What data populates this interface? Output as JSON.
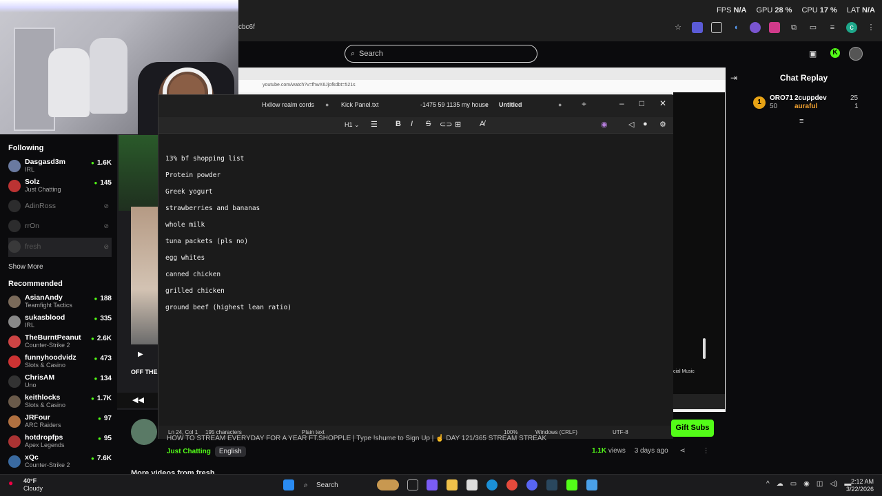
{
  "perf": {
    "fps_label": "FPS",
    "fps": "N/A",
    "gpu_label": "GPU",
    "gpu": "28 %",
    "cpu_label": "CPU",
    "cpu": "17 %",
    "lat_label": "LAT",
    "lat": "N/A"
  },
  "browser": {
    "url_fragment": "cbc6f"
  },
  "kick": {
    "search_placeholder": "Search"
  },
  "sidebar": {
    "following_title": "Following",
    "following": [
      {
        "name": "Dasgasd3m",
        "category": "IRL",
        "viewers": "1.6K"
      },
      {
        "name": "Solz",
        "category": "Just Chatting",
        "viewers": "145"
      }
    ],
    "offline": [
      {
        "name": "AdinRoss"
      },
      {
        "name": "rrOn"
      },
      {
        "name": "fresh"
      }
    ],
    "show_more": "Show More",
    "recommended_title": "Recommended",
    "recommended": [
      {
        "name": "AsianAndy",
        "category": "Teamfight Tactics",
        "viewers": "188"
      },
      {
        "name": "sukasblood",
        "category": "IRL",
        "viewers": "335"
      },
      {
        "name": "TheBurntPeanut",
        "category": "Counter-Strike 2",
        "viewers": "2.6K"
      },
      {
        "name": "funnyhoodvidz",
        "category": "Slots & Casino",
        "viewers": "473"
      },
      {
        "name": "ChrisAM",
        "category": "Uno",
        "viewers": "134"
      },
      {
        "name": "keithlocks",
        "category": "Slots & Casino",
        "viewers": "1.7K"
      },
      {
        "name": "JRFour",
        "category": "ARC Raiders",
        "viewers": "97"
      },
      {
        "name": "hotdropfps",
        "category": "Apex Legends",
        "viewers": "95"
      },
      {
        "name": "xQc",
        "category": "Counter-Strike 2",
        "viewers": "7.6K"
      }
    ]
  },
  "player": {
    "overlay_text": "OFF THE"
  },
  "stream": {
    "title": "HOW TO STREAM EVERYDAY FOR A YEAR FT.SHOPPLE | Type !shume to Sign Up | ☝ DAY 121/365 STREAM STREAK",
    "category": "Just Chatting",
    "language": "English",
    "views_count": "1.1K",
    "views_label": "views",
    "age": "3 days ago",
    "more_videos": "More videos from fresh",
    "gift_subs": "Gift Subs"
  },
  "chat": {
    "title": "Chat Replay",
    "gifter1": "ORO71",
    "gifter1_count": "50",
    "gifter2": "2cuppdev",
    "gifter2_count": "25",
    "gifter3": "auraful",
    "gifter3_count": "1"
  },
  "youtube": {
    "url": "youtube.com/watch?v=fhwX6Jjofkdbt=521s",
    "music_label": "cial Music"
  },
  "notepad": {
    "tabs": [
      "Hxllow realm cords",
      "Kick Panel.txt",
      "-1475 59 1135 my house",
      "Untitled"
    ],
    "heading": "H1",
    "lines": [
      "13% bf shopping list",
      "",
      "Protein powder",
      "",
      "Greek yogurt",
      "",
      "strawberries and bananas",
      "",
      "whole milk",
      "",
      "tuna packets (pls no)",
      "",
      "egg whites",
      "",
      "canned chicken",
      "",
      "grilled chicken",
      "",
      "ground beef (highest lean ratio)"
    ],
    "status": {
      "position": "Ln 24, Col 1",
      "chars": "195 characters",
      "format": "Plain text",
      "zoom": "100%",
      "eol": "Windows (CRLF)",
      "encoding": "UTF-8"
    }
  },
  "taskbar": {
    "temp": "40°F",
    "condition": "Cloudy",
    "search": "Search",
    "time": "2:12 AM",
    "date": "3/22/2026"
  },
  "colors": {
    "kick_green": "#53fc18",
    "notepad_bg": "#1b1b1b"
  }
}
